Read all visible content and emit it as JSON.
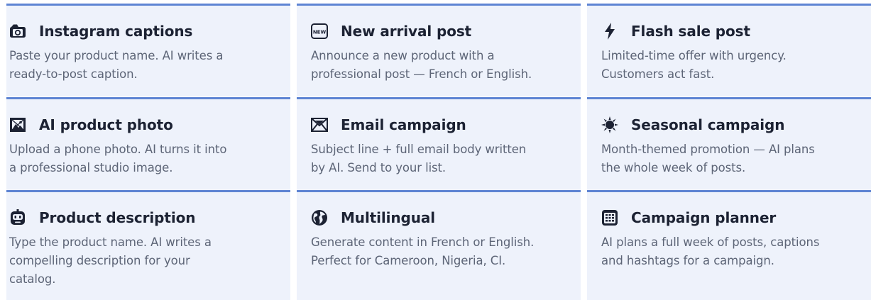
{
  "features": [
    {
      "icon": "camera-icon",
      "title": "Instagram captions",
      "description": "Paste your product name. AI writes a\nready-to-post caption."
    },
    {
      "icon": "new-badge-icon",
      "title": "New arrival post",
      "description": "Announce a new product with a\nprofessional post — French or English."
    },
    {
      "icon": "lightning-icon",
      "title": "Flash sale post",
      "description": "Limited-time offer with urgency.\nCustomers act fast."
    },
    {
      "icon": "framed-picture-icon",
      "title": "AI product photo",
      "description": "Upload a phone photo. AI turns it into\na professional studio image."
    },
    {
      "icon": "envelope-icon",
      "title": "Email campaign",
      "description": "Subject line + full email body written\nby AI. Send to your list."
    },
    {
      "icon": "sparkle-sun-icon",
      "title": "Seasonal campaign",
      "description": "Month-themed promotion — AI plans\nthe whole week of posts."
    },
    {
      "icon": "robot-icon",
      "title": "Product description",
      "description": "Type the product name. AI writes a\ncompelling description for your\ncatalog."
    },
    {
      "icon": "globe-icon",
      "title": "Multilingual",
      "description": "Generate content in French or English.\nPerfect for Cameroon, Nigeria, CI."
    },
    {
      "icon": "calendar-icon",
      "title": "Campaign planner",
      "description": "AI plans a full week of posts, captions\nand hashtags for a campaign."
    }
  ]
}
